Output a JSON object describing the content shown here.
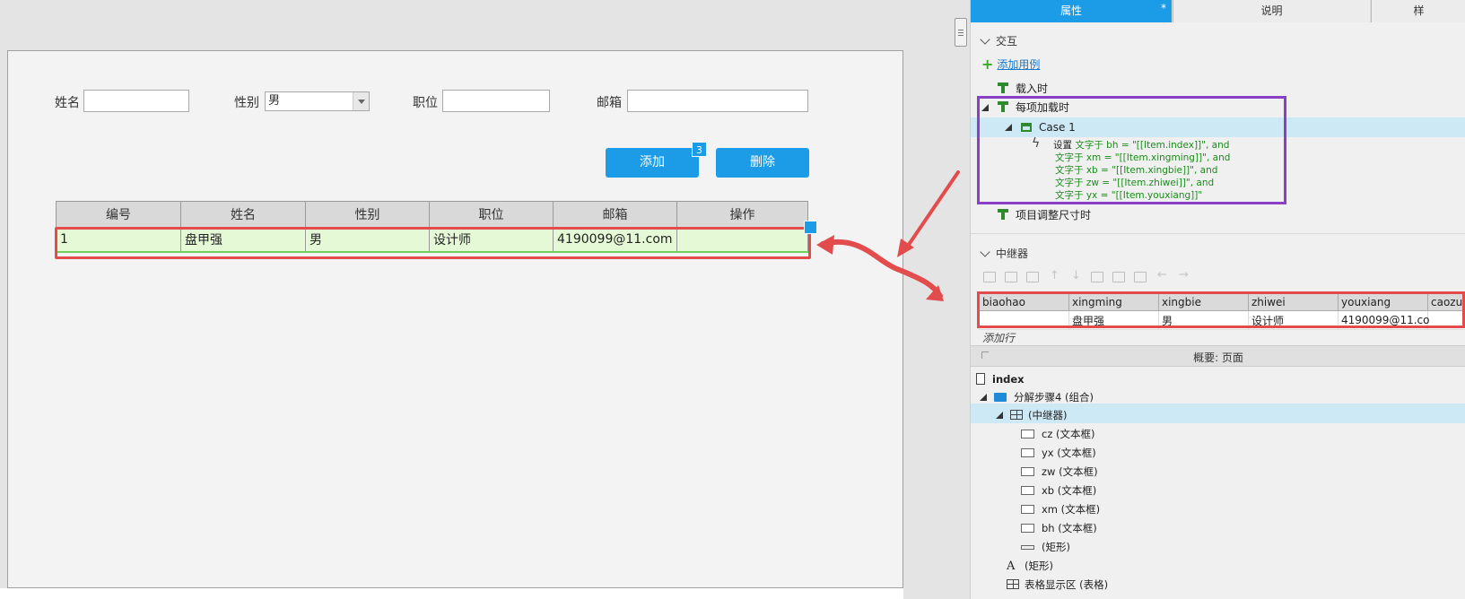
{
  "form": {
    "name_label": "姓名",
    "name_value": "",
    "gender_label": "性别",
    "gender_value": "男",
    "position_label": "职位",
    "position_value": "",
    "email_label": "邮箱",
    "email_value": ""
  },
  "buttons": {
    "add_label": "添加",
    "add_badge": "3",
    "delete_label": "删除"
  },
  "table": {
    "headers": [
      "编号",
      "姓名",
      "性别",
      "职位",
      "邮箱",
      "操作"
    ],
    "rows": [
      [
        "1",
        "盘甲强",
        "男",
        "设计师",
        "4190099@11.com",
        ""
      ]
    ]
  },
  "inspector": {
    "tabs": {
      "properties": "属性",
      "properties_mark": "*",
      "notes": "说明",
      "more": "样"
    },
    "interaction_title": "交互",
    "add_case": "添加用例",
    "events": {
      "on_load": "载入时",
      "on_item_load": "每项加载时",
      "case_name": "Case 1",
      "on_item_resize": "项目调整尺寸时"
    },
    "action": {
      "verb": "设置",
      "lines": [
        "文字于 bh = \"[[Item.index]]\", and",
        "文字于 xm = \"[[Item.xingming]]\", and",
        "文字于 xb = \"[[Item.xingbie]]\", and",
        "文字于 zw = \"[[Item.zhiwei]]\", and",
        "文字于 yx = \"[[Item.youxiang]]\""
      ]
    },
    "repeater_title": "中继器",
    "repeater": {
      "columns": [
        "biaohao",
        "xingming",
        "xingbie",
        "zhiwei",
        "youxiang",
        "caozuo"
      ],
      "rows": [
        [
          "",
          "盘甲强",
          "男",
          "设计师",
          "4190099@11.co",
          ""
        ]
      ],
      "add_row": "添加行"
    }
  },
  "outline": {
    "title": "概要: 页面",
    "items": {
      "page": "index",
      "group": "分解步骤4 (组合)",
      "repeater": "(中继器)",
      "cz": "cz (文本框)",
      "yx": "yx (文本框)",
      "zw": "zw (文本框)",
      "xb": "xb (文本框)",
      "xm": "xm (文本框)",
      "bh": "bh (文本框)",
      "rect1": "(矩形)",
      "rect2": "(矩形)",
      "table_area": "表格显示区 (表格)"
    }
  },
  "colors": {
    "accent": "#1c9be6",
    "highlight_red": "#e24c4c",
    "highlight_purple": "#8a3fc7",
    "row_green": "#e5f9d6",
    "selection_blue": "#cde9f6"
  }
}
